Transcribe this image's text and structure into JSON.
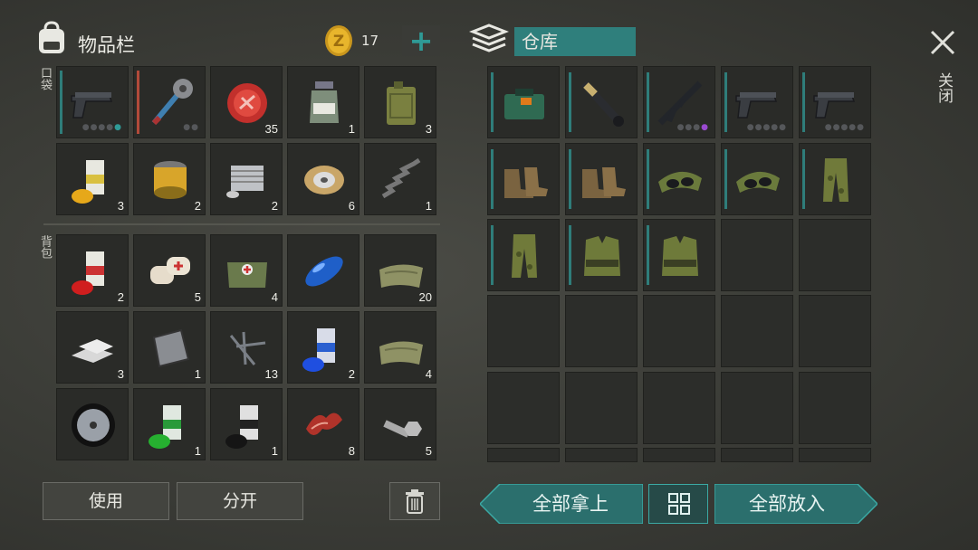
{
  "inventory": {
    "title": "物品栏",
    "coin_count": "17",
    "pocket_label": "口袋",
    "backpack_label": "背包"
  },
  "storage": {
    "title": "仓库"
  },
  "close": {
    "label": "关闭"
  },
  "buttons": {
    "use": "使用",
    "split": "分开",
    "take_all": "全部拿上",
    "put_all": "全部放入"
  },
  "pocket_items": [
    {
      "name": "pistol",
      "count": ""
    },
    {
      "name": "spiked-club",
      "count": ""
    },
    {
      "name": "bottle-cap",
      "count": "35"
    },
    {
      "name": "glass-jar",
      "count": "1"
    },
    {
      "name": "jerrycan",
      "count": "3"
    },
    {
      "name": "spray-paint-yellow",
      "count": "3"
    },
    {
      "name": "air-filter",
      "count": "2"
    },
    {
      "name": "engine-block",
      "count": "2"
    },
    {
      "name": "wire-spool",
      "count": "6"
    },
    {
      "name": "spring",
      "count": "1"
    }
  ],
  "backpack_items": [
    {
      "name": "spray-paint-red",
      "count": "2"
    },
    {
      "name": "bandage",
      "count": "5"
    },
    {
      "name": "medical-bag",
      "count": "4"
    },
    {
      "name": "blue-fuel-tank",
      "count": ""
    },
    {
      "name": "cloth",
      "count": "20"
    },
    {
      "name": "metal-bars",
      "count": "3"
    },
    {
      "name": "metal-plate",
      "count": "1"
    },
    {
      "name": "nails",
      "count": "13"
    },
    {
      "name": "spray-paint-blue",
      "count": "2"
    },
    {
      "name": "cloth",
      "count": "4"
    },
    {
      "name": "wheel",
      "count": ""
    },
    {
      "name": "spray-paint-green",
      "count": "1"
    },
    {
      "name": "spray-paint-black",
      "count": "1"
    },
    {
      "name": "raw-meat",
      "count": "8"
    },
    {
      "name": "bolt-nut",
      "count": "5"
    }
  ],
  "storage_items": [
    {
      "name": "explosive-case",
      "count": ""
    },
    {
      "name": "grenade-launcher",
      "count": ""
    },
    {
      "name": "assault-rifle",
      "count": ""
    },
    {
      "name": "pistol",
      "count": ""
    },
    {
      "name": "pistol",
      "count": ""
    },
    {
      "name": "boots",
      "count": ""
    },
    {
      "name": "boots",
      "count": ""
    },
    {
      "name": "camo-cap-goggles",
      "count": ""
    },
    {
      "name": "camo-cap-goggles",
      "count": ""
    },
    {
      "name": "camo-pants",
      "count": ""
    },
    {
      "name": "camo-pants",
      "count": ""
    },
    {
      "name": "camo-vest",
      "count": ""
    },
    {
      "name": "camo-vest",
      "count": ""
    }
  ],
  "colors": {
    "accent": "#2f9a96",
    "panel": "#2a2b28",
    "button": "#2b6f6d"
  }
}
